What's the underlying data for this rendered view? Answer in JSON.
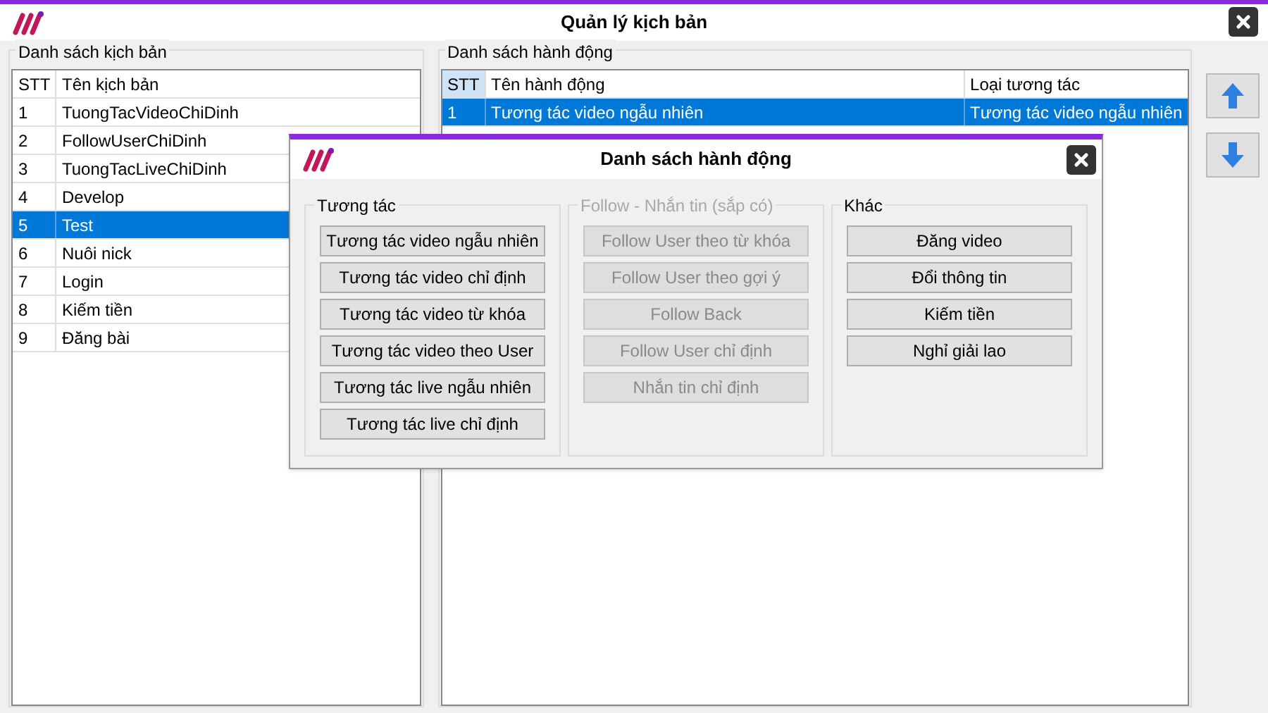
{
  "window": {
    "title": "Quản lý kịch bản"
  },
  "scripts": {
    "title": "Danh sách kịch bản",
    "columns": [
      "STT",
      "Tên kịch bản"
    ],
    "rows": [
      {
        "cells": [
          "1",
          "TuongTacVideoChiDinh"
        ],
        "selected": false
      },
      {
        "cells": [
          "2",
          "FollowUserChiDinh"
        ],
        "selected": false
      },
      {
        "cells": [
          "3",
          "TuongTacLiveChiDinh"
        ],
        "selected": false
      },
      {
        "cells": [
          "4",
          "Develop"
        ],
        "selected": false
      },
      {
        "cells": [
          "5",
          "Test"
        ],
        "selected": true
      },
      {
        "cells": [
          "6",
          "Nuôi nick"
        ],
        "selected": false
      },
      {
        "cells": [
          "7",
          "Login"
        ],
        "selected": false
      },
      {
        "cells": [
          "8",
          "Kiếm tiền"
        ],
        "selected": false
      },
      {
        "cells": [
          "9",
          "Đăng bài"
        ],
        "selected": false
      }
    ]
  },
  "actions": {
    "title": "Danh sách hành động",
    "columns": [
      "STT",
      "Tên hành động",
      "Loại tương tác"
    ],
    "rows": [
      {
        "cells": [
          "1",
          "Tương tác video ngẫu nhiên",
          "Tương tác video ngẫu nhiên"
        ],
        "selected": true
      }
    ]
  },
  "dialog": {
    "title": "Danh sách hành động",
    "groups": [
      {
        "title": "Tương tác",
        "disabled": false,
        "buttons": [
          "Tương tác video ngẫu nhiên",
          "Tương tác video chỉ định",
          "Tương tác video từ khóa",
          "Tương tác video theo User",
          "Tương tác live ngẫu nhiên",
          "Tương tác live chỉ định"
        ]
      },
      {
        "title": "Follow - Nhắn tin (sắp có)",
        "disabled": true,
        "buttons": [
          "Follow User theo từ khóa",
          "Follow User theo gợi ý",
          "Follow Back",
          "Follow User chỉ định",
          "Nhắn tin chỉ định"
        ]
      },
      {
        "title": "Khác",
        "disabled": false,
        "buttons": [
          "Đăng video",
          "Đổi thông tin",
          "Kiếm tiền",
          "Nghỉ giải lao"
        ]
      }
    ]
  }
}
